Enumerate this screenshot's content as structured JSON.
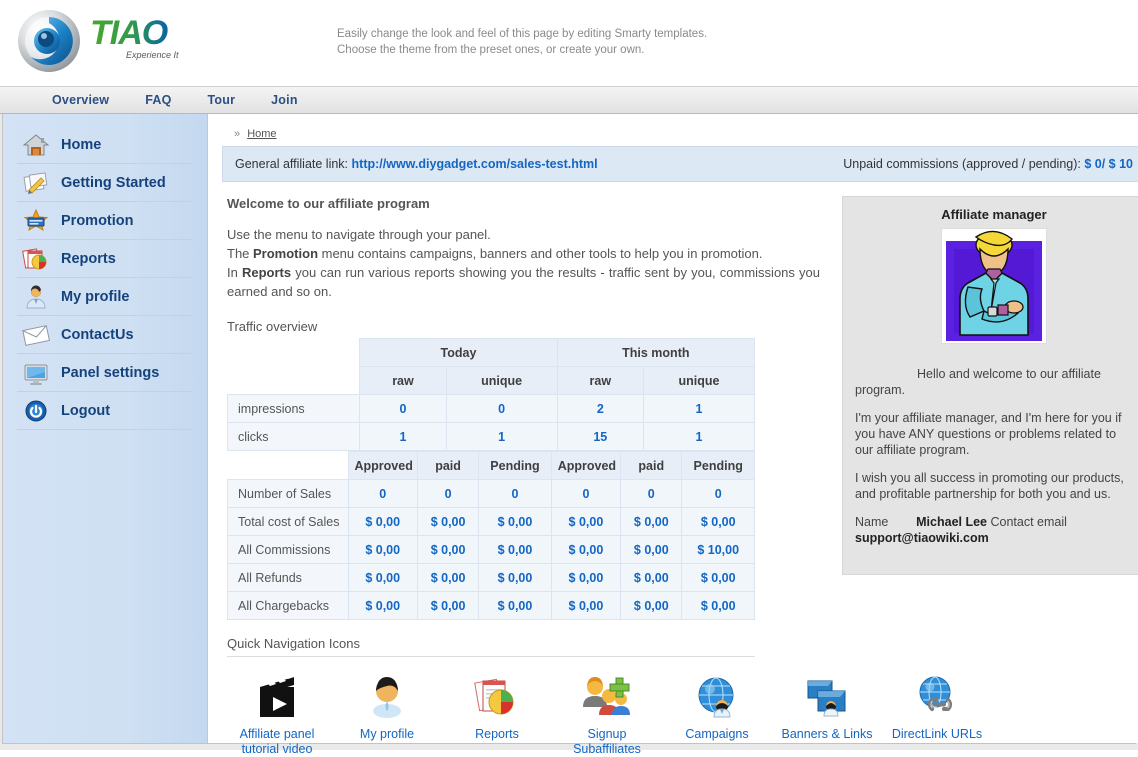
{
  "brand": {
    "name": "TIAO",
    "tagline": "Experience It",
    "logo_icon": "tiao-swirl-logo"
  },
  "header": {
    "promo_line1": "Easily change the look and feel of this page by editing Smarty templates.",
    "promo_line2": "Choose the theme from the preset ones, or create your own."
  },
  "topnav": {
    "items": [
      {
        "label": "Overview"
      },
      {
        "label": "FAQ"
      },
      {
        "label": "Tour"
      },
      {
        "label": "Join"
      }
    ]
  },
  "sidebar": {
    "items": [
      {
        "label": "Home",
        "icon": "home-icon"
      },
      {
        "label": "Getting Started",
        "icon": "pencil-note-icon"
      },
      {
        "label": "Promotion",
        "icon": "star-badge-icon"
      },
      {
        "label": "Reports",
        "icon": "report-chart-icon"
      },
      {
        "label": "My profile",
        "icon": "user-icon"
      },
      {
        "label": "ContactUs",
        "icon": "envelope-icon"
      },
      {
        "label": "Panel settings",
        "icon": "monitor-icon"
      },
      {
        "label": "Logout",
        "icon": "power-icon"
      }
    ]
  },
  "breadcrumb": {
    "chevron": "»",
    "home": "Home"
  },
  "linkbar": {
    "label": "General affiliate link:",
    "url": "http://www.diygadget.com/sales-test.html",
    "commissions_label": "Unpaid commissions (approved / pending):",
    "commissions_value": "$ 0/ $ 10"
  },
  "main": {
    "welcome_title": "Welcome to our affiliate program",
    "intro_line1": "Use the menu to navigate through your panel.",
    "intro_line2_a": "The ",
    "intro_line2_b": "Promotion",
    "intro_line2_c": " menu contains campaigns, banners and other tools to help you in promotion.",
    "intro_line3_a": "In ",
    "intro_line3_b": "Reports",
    "intro_line3_c": " you can run various reports showing you the results - traffic sent by you, commissions you earned and so on.",
    "traffic_title": "Traffic overview",
    "quicknav_title": "Quick Navigation Icons"
  },
  "traffic_table": {
    "period_headers": [
      "Today",
      "This month"
    ],
    "sub_headers": [
      "raw",
      "unique",
      "raw",
      "unique"
    ],
    "rows": [
      {
        "label": "impressions",
        "values": [
          "0",
          "0",
          "2",
          "1"
        ]
      },
      {
        "label": "clicks",
        "values": [
          "1",
          "1",
          "15",
          "1"
        ]
      }
    ]
  },
  "sales_table": {
    "headers": [
      "Approved",
      "paid",
      "Pending",
      "Approved",
      "paid",
      "Pending"
    ],
    "rows": [
      {
        "label": "Number of Sales",
        "values": [
          "0",
          "0",
          "0",
          "0",
          "0",
          "0"
        ]
      },
      {
        "label": "Total cost of Sales",
        "values": [
          "$ 0,00",
          "$ 0,00",
          "$ 0,00",
          "$ 0,00",
          "$ 0,00",
          "$ 0,00"
        ]
      },
      {
        "label": "All Commissions",
        "values": [
          "$ 0,00",
          "$ 0,00",
          "$ 0,00",
          "$ 0,00",
          "$ 0,00",
          "$ 10,00"
        ]
      },
      {
        "label": "All Refunds",
        "values": [
          "$ 0,00",
          "$ 0,00",
          "$ 0,00",
          "$ 0,00",
          "$ 0,00",
          "$ 0,00"
        ]
      },
      {
        "label": "All Chargebacks",
        "values": [
          "$ 0,00",
          "$ 0,00",
          "$ 0,00",
          "$ 0,00",
          "$ 0,00",
          "$ 0,00"
        ]
      }
    ]
  },
  "quicknav": {
    "items": [
      {
        "label": "Affiliate panel tutorial video",
        "icon": "film-clapper-play-icon"
      },
      {
        "label": "My profile",
        "icon": "user-avatar-icon"
      },
      {
        "label": "Reports",
        "icon": "report-piechart-icon"
      },
      {
        "label": "Signup Subaffiliates",
        "icon": "users-plus-icon"
      },
      {
        "label": "Campaigns",
        "icon": "globe-user-icon"
      },
      {
        "label": "Banners & Links",
        "icon": "screens-user-icon"
      },
      {
        "label": "DirectLink URLs",
        "icon": "globe-chain-icon"
      }
    ]
  },
  "affiliate_manager": {
    "title": "Affiliate manager",
    "photo_icon": "manager-portrait-illustration",
    "greeting": "Hello and welcome to our affiliate program.",
    "body1": "I'm your affiliate manager, and I'm here for you if you have ANY questions or problems related to our affiliate program.",
    "body2": "I wish you all success in promoting our products, and profitable partnership for both you and us.",
    "name_label": "Name",
    "name_value": "Michael Lee",
    "email_label": "Contact email",
    "email_value": "support@tiaowiki.com"
  },
  "colors": {
    "link_blue": "#1366c4",
    "sidebar_text": "#16427c",
    "table_header_bg": "#e7eef7",
    "linkbar_bg": "#dde8f5",
    "manager_box_bg": "#e4e4e4"
  }
}
